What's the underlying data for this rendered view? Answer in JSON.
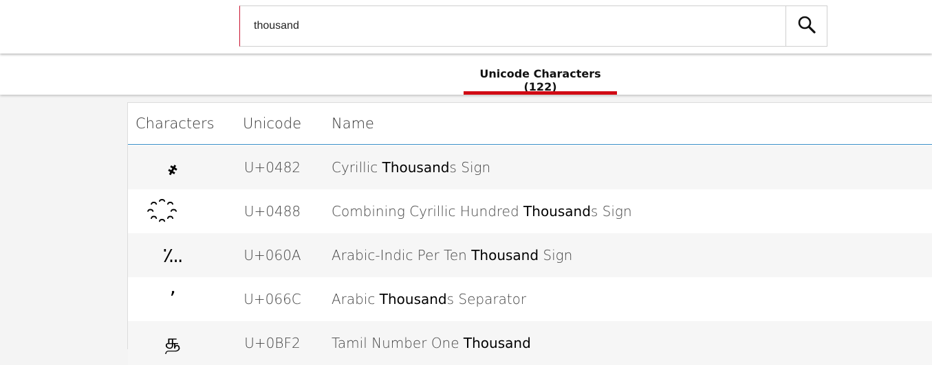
{
  "search": {
    "value": "thousand",
    "button_icon": "search-icon",
    "accent_color": "#c8102e"
  },
  "tabs": [
    {
      "label": "Unicode Characters (122)",
      "active": true,
      "underline_color": "#d10a14"
    }
  ],
  "table": {
    "headers": [
      "Characters",
      "Unicode",
      "Name"
    ],
    "header_border_color": "#3a8fc7",
    "rows": [
      {
        "char": "҂",
        "code": "U+0482",
        "name_pre": "Cyrillic ",
        "name_hl": "Thousand",
        "name_post": "s Sign"
      },
      {
        "char": "҈",
        "code": "U+0488",
        "name_pre": "Combining Cyrillic Hundred ",
        "name_hl": "Thousand",
        "name_post": "s Sign"
      },
      {
        "char": "؊",
        "code": "U+060A",
        "name_pre": "Arabic-Indic Per Ten ",
        "name_hl": "Thousand",
        "name_post": " Sign"
      },
      {
        "char": "٬",
        "code": "U+066C",
        "name_pre": "Arabic ",
        "name_hl": "Thousand",
        "name_post": "s Separator"
      },
      {
        "char": "௲",
        "code": "U+0BF2",
        "name_pre": "Tamil Number One ",
        "name_hl": "Thousand",
        "name_post": ""
      }
    ]
  }
}
